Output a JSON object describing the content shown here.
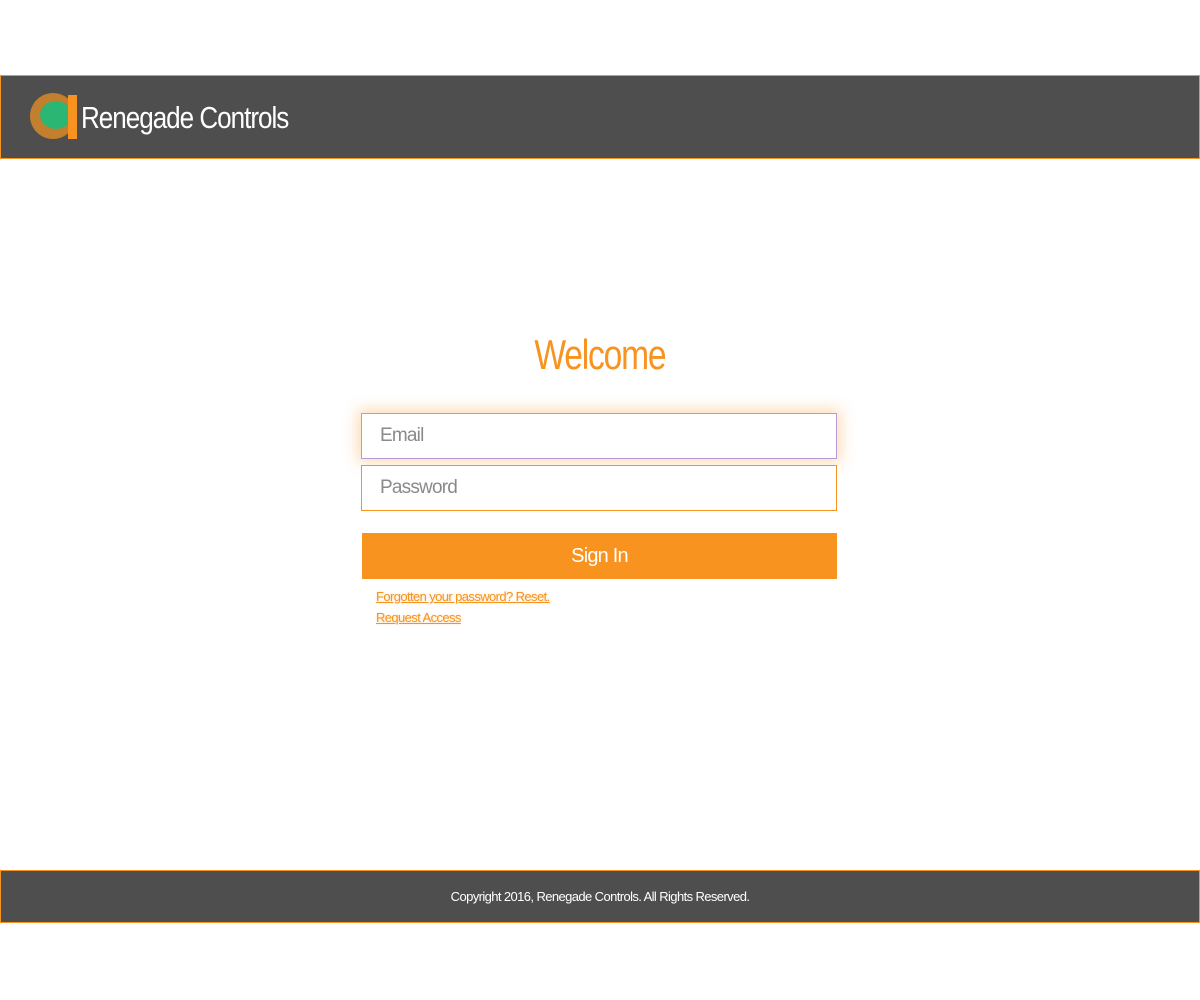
{
  "header": {
    "brand_name": "Renegade Controls"
  },
  "main": {
    "title": "Welcome",
    "email_placeholder": "Email",
    "password_placeholder": "Password",
    "signin_label": "Sign In",
    "forgot_password_link": "Forgotten your password? Reset.",
    "request_access_link": "Request Access"
  },
  "footer": {
    "copyright": "Copyright 2016, Renegade Controls. All Rights Reserved."
  },
  "colors": {
    "accent": "#f7931e",
    "header_bg": "#4e4e4e",
    "logo_green": "#2bb673",
    "logo_brown": "#c27f2e"
  },
  "icons": {
    "logo": "renegade-logo-icon"
  }
}
